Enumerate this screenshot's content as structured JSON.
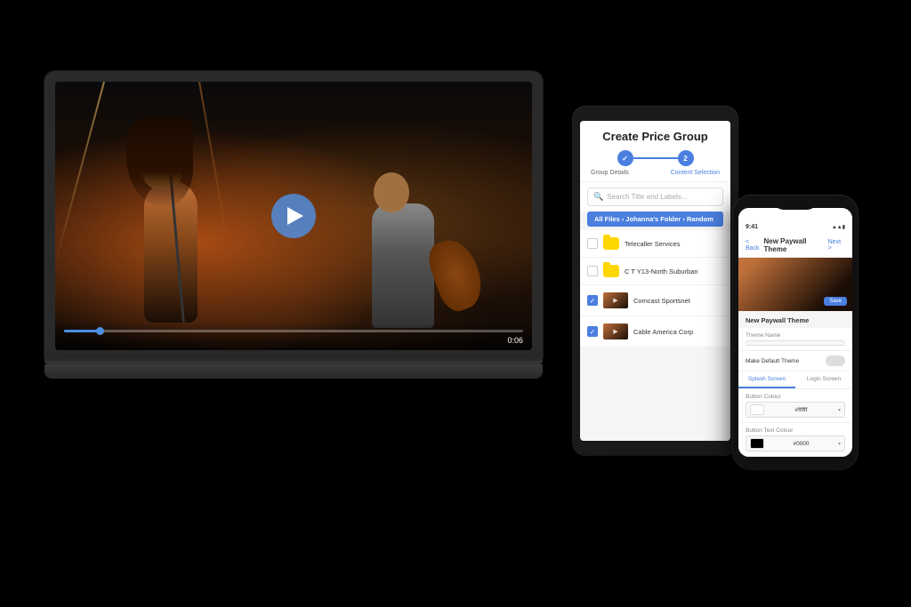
{
  "scene": {
    "background": "#000000"
  },
  "laptop": {
    "video": {
      "time": "0:06",
      "play_button_label": "Play"
    }
  },
  "tablet": {
    "title": "Create Price Group",
    "stepper": {
      "step1_label": "Group Details",
      "step2_label": "Content Selection"
    },
    "search": {
      "placeholder": "Search Title and Labels..."
    },
    "breadcrumb": "All Files › Johanna's Folder › Random",
    "list_items": [
      {
        "name": "Telecaller Services",
        "type": "folder",
        "checked": false
      },
      {
        "name": "C T Y13-North Suburban",
        "type": "folder",
        "checked": false
      },
      {
        "name": "Comcast Sportsnet",
        "type": "video",
        "checked": true
      },
      {
        "name": "Cable America Corp",
        "type": "video",
        "checked": true
      }
    ]
  },
  "phone": {
    "status_bar": {
      "time": "9:41",
      "icons": "▲▲▮"
    },
    "header": {
      "back_label": "< Back",
      "title": "New Paywall Theme",
      "next_label": "Next >"
    },
    "section_label": "New Paywall Theme",
    "fields": [
      {
        "label": "Theme Name",
        "value": "",
        "placeholder": ""
      },
      {
        "label": "Make Default Theme",
        "type": "toggle"
      }
    ],
    "tabs": [
      "Splash Screen",
      "Login Screen"
    ],
    "button_color_label": "Button Colour",
    "button_color_value": "#ffffff",
    "button_text_color_label": "Button Text Colour",
    "button_text_color_value": "#0000"
  }
}
